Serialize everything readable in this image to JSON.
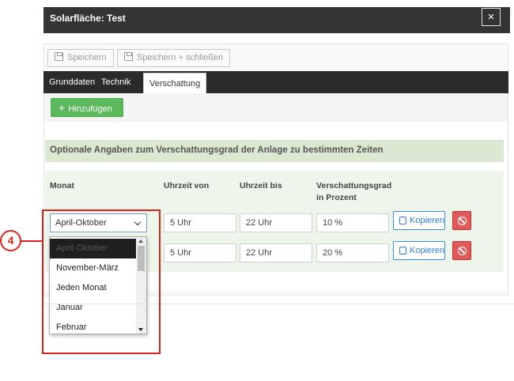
{
  "dialog": {
    "title": "Solarfläche: Test",
    "close_label": "×"
  },
  "toolbar": {
    "save_label": "Speichern",
    "save_close_label": "Speichern + schließen"
  },
  "tabs": [
    {
      "label": "Grunddaten",
      "active": false
    },
    {
      "label": "Technik",
      "active": false
    },
    {
      "label": "Verschattung",
      "active": true
    }
  ],
  "add_button": {
    "icon": "+",
    "label": "Hinzufügen"
  },
  "section": {
    "title": "Optionale Angaben zum Verschattungsgrad der Anlage zu bestimmten Zeiten"
  },
  "table": {
    "headers": {
      "month": "Monat",
      "time_from": "Uhrzeit von",
      "time_to": "Uhrzeit bis",
      "shading_line1": "Verschattungsgrad",
      "shading_line2": "in Prozent"
    },
    "rows": [
      {
        "month": "April-Oktober",
        "time_from": "5 Uhr",
        "time_to": "22 Uhr",
        "shading": "10 %",
        "copy_label": "Kopieren"
      },
      {
        "month": "",
        "time_from": "5 Uhr",
        "time_to": "22 Uhr",
        "shading": "20 %",
        "copy_label": "Kopieren"
      }
    ]
  },
  "dropdown": {
    "options": [
      "April-Oktober",
      "November-März",
      "Jeden Monat",
      "Januar",
      "Februar"
    ],
    "selected_index": 0
  },
  "annotation": {
    "step": "4",
    "color": "#d9231d"
  },
  "colors": {
    "header_bg": "#343434",
    "tabs_bg": "#2b2b2b",
    "add_button": "#5cb85c",
    "section_bg": "#dbe9d3",
    "copy_button": "#2e7dd6",
    "delete_button": "#e05a5a"
  }
}
